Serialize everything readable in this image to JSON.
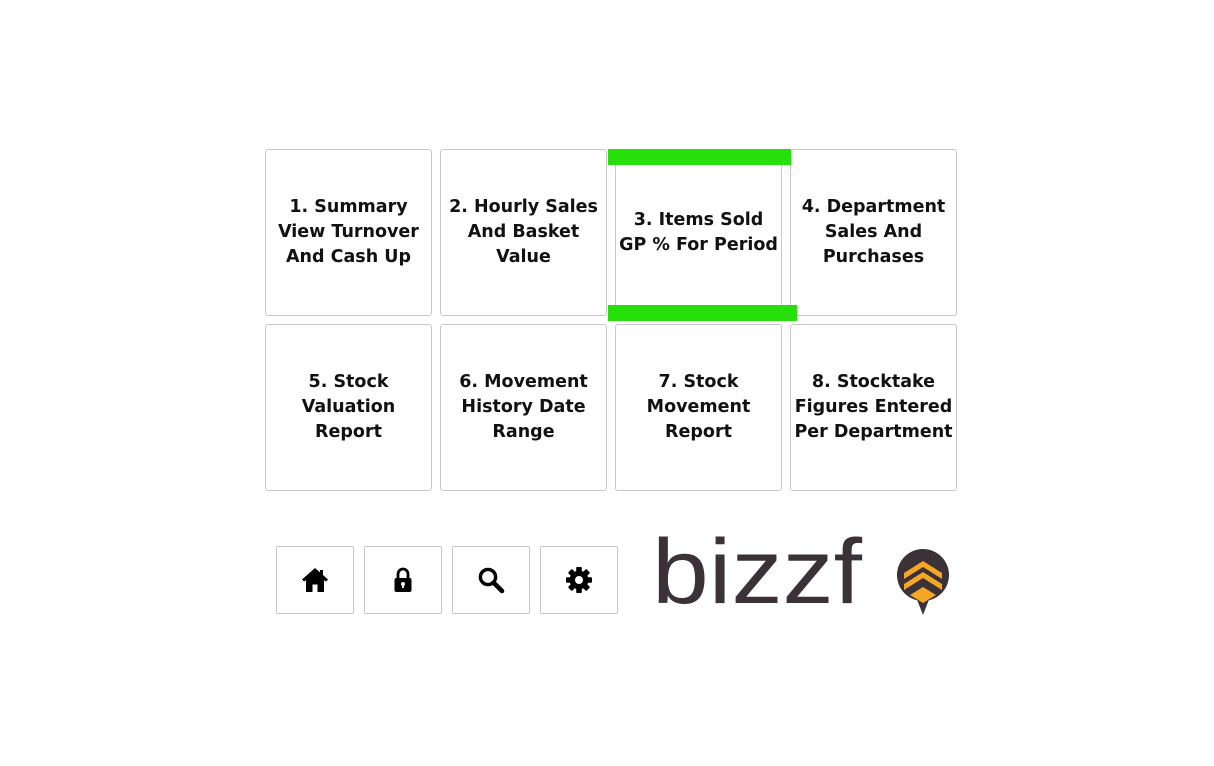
{
  "tiles": [
    {
      "label": "1. Summary View Turnover And Cash Up"
    },
    {
      "label": "2. Hourly Sales And Basket Value"
    },
    {
      "label": "3. Items Sold GP % For Period"
    },
    {
      "label": "4. Department Sales And Purchases"
    },
    {
      "label": "5. Stock Valuation Report"
    },
    {
      "label": "6. Movement History Date Range"
    },
    {
      "label": "7. Stock Movement Report"
    },
    {
      "label": "8. Stocktake Figures Entered Per Department"
    }
  ],
  "toolbar": {
    "buttons": [
      {
        "icon": "home-icon"
      },
      {
        "icon": "lock-icon"
      },
      {
        "icon": "search-icon"
      },
      {
        "icon": "gear-icon"
      }
    ]
  },
  "logo": {
    "text": "bizzf",
    "colors": {
      "text": "#3a3237",
      "accent": "#f5a623"
    }
  },
  "colors": {
    "highlight": "#27e00b",
    "border": "#c8c8c8",
    "text": "#111111"
  }
}
